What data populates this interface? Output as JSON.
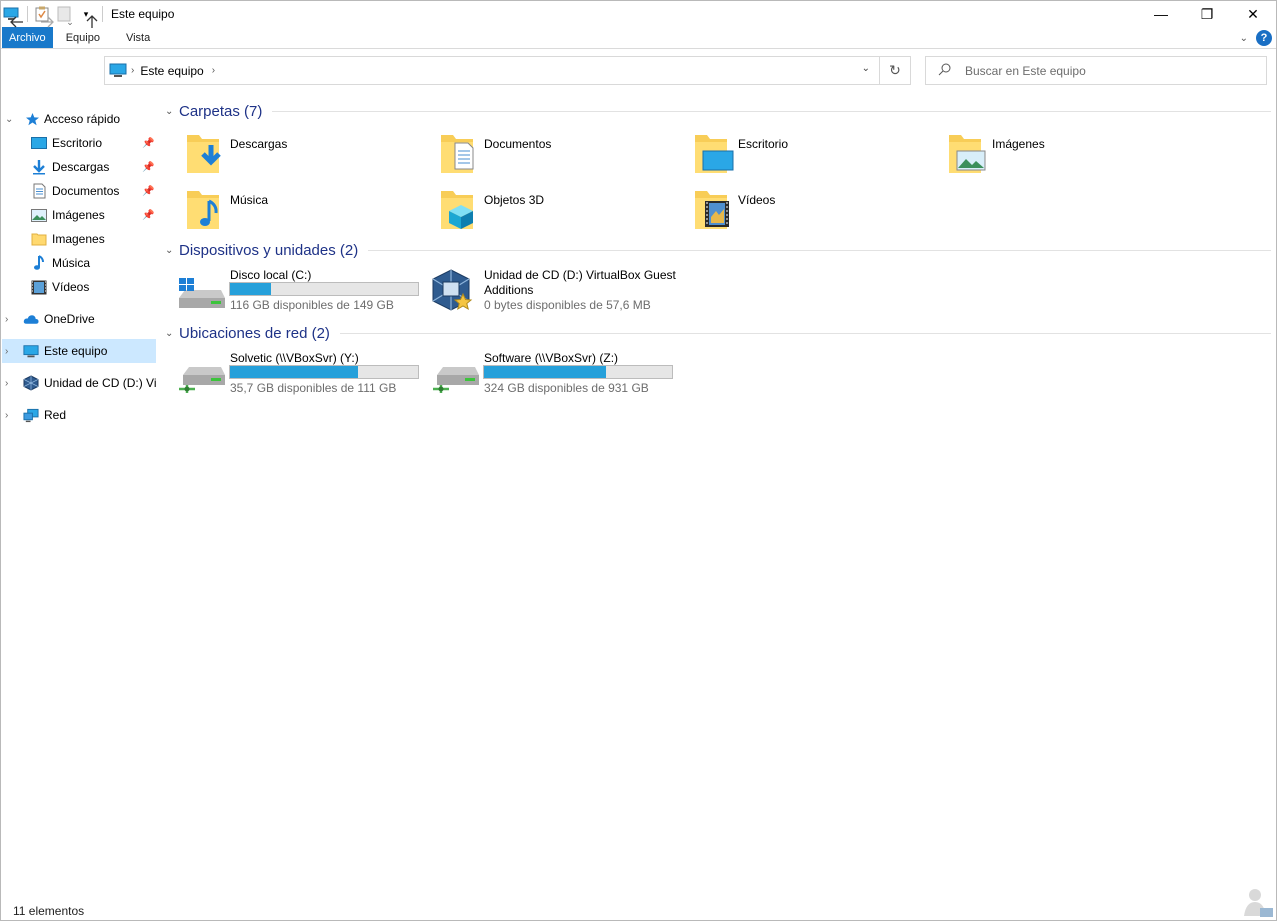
{
  "window": {
    "title": "Este equipo",
    "controls": {
      "minimize": "—",
      "restore": "❐",
      "close": "✕"
    }
  },
  "ribbon": {
    "tabs": [
      "Archivo",
      "Equipo",
      "Vista"
    ],
    "help": "?"
  },
  "address": {
    "path": "Este equipo",
    "search_placeholder": "Buscar en Este equipo"
  },
  "sidebar": {
    "quick_access": "Acceso rápido",
    "quick_items": [
      {
        "label": "Escritorio",
        "icon": "desktop-icon",
        "pinned": true
      },
      {
        "label": "Descargas",
        "icon": "download-icon",
        "pinned": true
      },
      {
        "label": "Documentos",
        "icon": "document-icon",
        "pinned": true
      },
      {
        "label": "Imágenes",
        "icon": "pictures-icon",
        "pinned": true
      },
      {
        "label": "Imagenes",
        "icon": "folder-icon",
        "pinned": false
      },
      {
        "label": "Música",
        "icon": "music-icon",
        "pinned": false
      },
      {
        "label": "Vídeos",
        "icon": "videos-icon",
        "pinned": false
      }
    ],
    "onedrive": "OneDrive",
    "this_pc": "Este equipo",
    "cd_drive": "Unidad de CD (D:) VirtualBox Guest Additions",
    "network": "Red"
  },
  "sections": {
    "folders": {
      "title": "Carpetas (7)",
      "items": [
        "Descargas",
        "Documentos",
        "Escritorio",
        "Imágenes",
        "Música",
        "Objetos 3D",
        "Vídeos"
      ]
    },
    "devices": {
      "title": "Dispositivos y unidades (2)",
      "items": [
        {
          "name": "Disco local (C:)",
          "free": "116 GB disponibles de 149 GB",
          "used_fraction": 0.22
        },
        {
          "name_line1": "Unidad de CD (D:) VirtualBox Guest",
          "name_line2": "Additions",
          "free": "0 bytes disponibles de 57,6 MB"
        }
      ]
    },
    "network": {
      "title": "Ubicaciones de red (2)",
      "items": [
        {
          "name": "Solvetic (\\\\VBoxSvr) (Y:)",
          "free": "35,7 GB disponibles de 111 GB",
          "used_fraction": 0.68
        },
        {
          "name": "Software (\\\\VBoxSvr) (Z:)",
          "free": "324 GB disponibles de 931 GB",
          "used_fraction": 0.65
        }
      ]
    }
  },
  "status": {
    "count": "11 elementos"
  },
  "colors": {
    "accent": "#1979ca",
    "bar_fill": "#26a0da",
    "selection": "#cce8ff",
    "section_header": "#1e3287"
  }
}
